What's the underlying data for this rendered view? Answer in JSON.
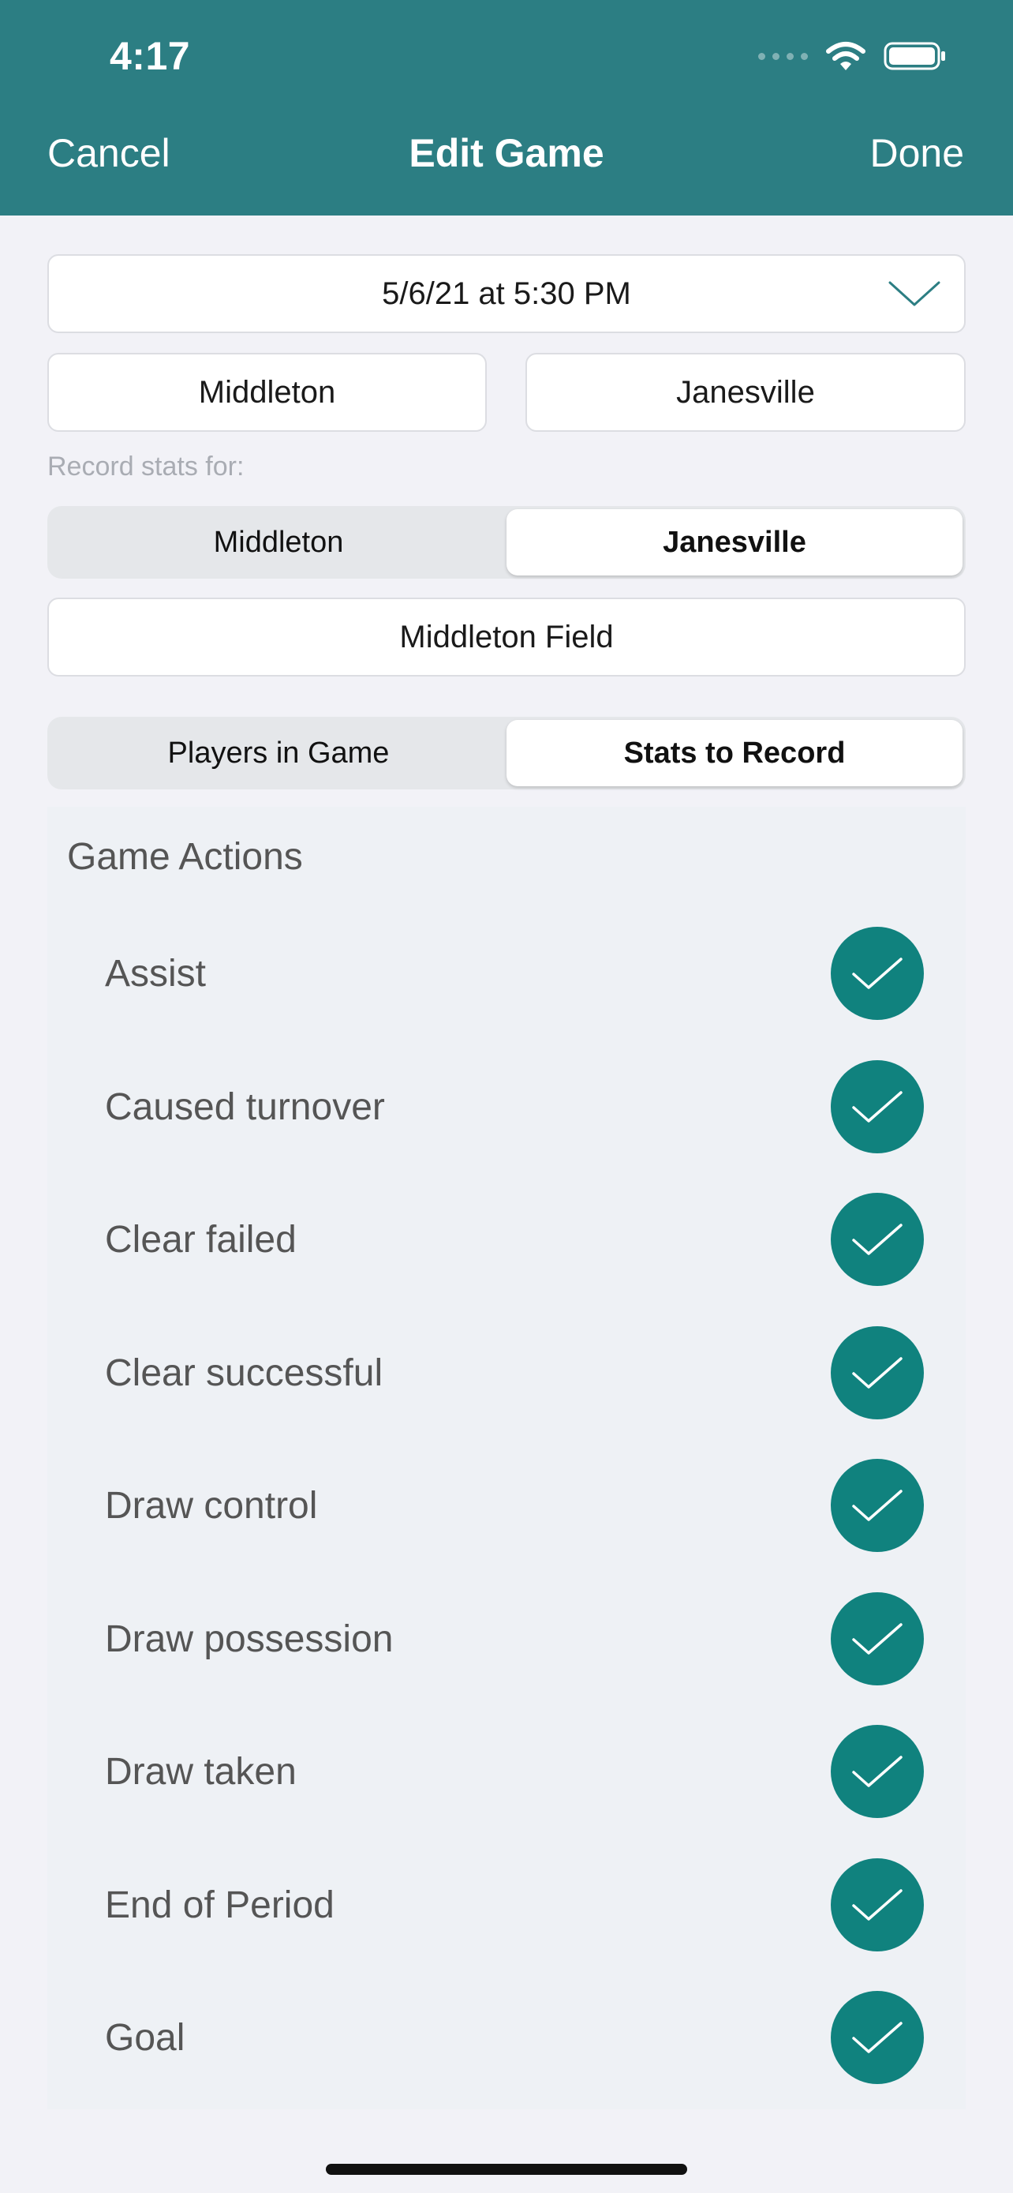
{
  "status_bar": {
    "time": "4:17"
  },
  "nav": {
    "cancel_label": "Cancel",
    "title": "Edit Game",
    "done_label": "Done"
  },
  "game": {
    "datetime": "5/6/21 at 5:30 PM",
    "team_home": "Middleton",
    "team_away": "Janesville",
    "venue": "Middleton Field"
  },
  "record_stats": {
    "label": "Record stats for:",
    "options": [
      "Middleton",
      "Janesville"
    ],
    "selected": "Janesville"
  },
  "tabs": {
    "options": [
      "Players in Game",
      "Stats to Record"
    ],
    "selected": "Stats to Record"
  },
  "actions": {
    "title": "Game Actions",
    "items": [
      {
        "label": "Assist",
        "checked": true
      },
      {
        "label": "Caused turnover",
        "checked": true
      },
      {
        "label": "Clear failed",
        "checked": true
      },
      {
        "label": "Clear successful",
        "checked": true
      },
      {
        "label": "Draw control",
        "checked": true
      },
      {
        "label": "Draw possession",
        "checked": true
      },
      {
        "label": "Draw taken",
        "checked": true
      },
      {
        "label": "End of Period",
        "checked": true
      },
      {
        "label": "Goal",
        "checked": true
      }
    ]
  },
  "colors": {
    "header": "#2c7e83",
    "check": "#10827e",
    "panel": "#eef1f5"
  },
  "icons": {
    "date_dropdown": "chevron-down-icon",
    "checkmark": "checkmark-icon"
  }
}
